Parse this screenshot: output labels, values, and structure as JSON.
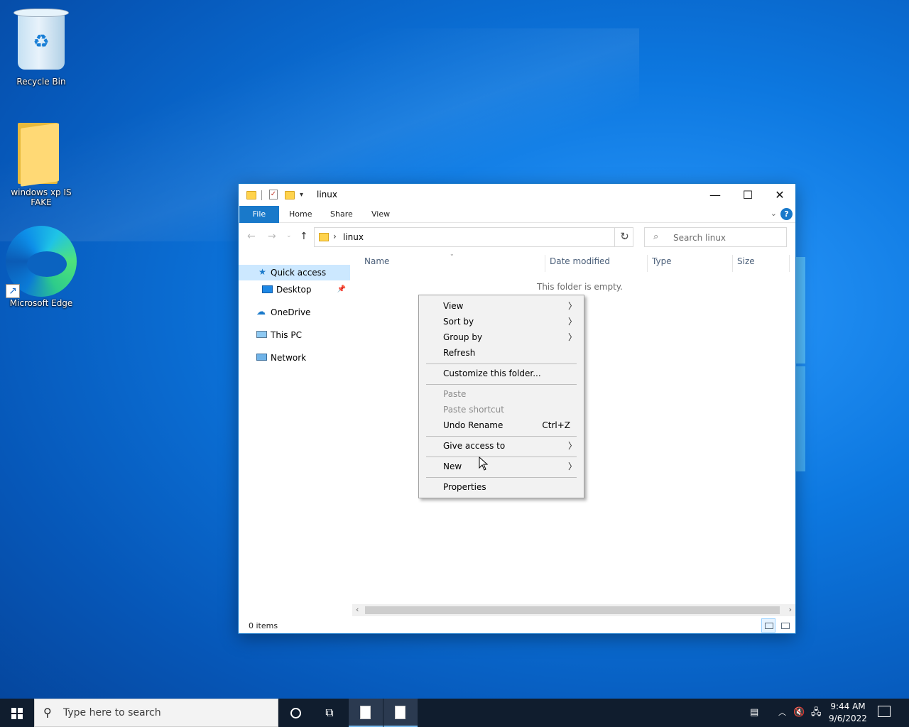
{
  "desktop": {
    "icons": [
      {
        "label": "Recycle Bin",
        "icon": "recycle-bin-icon"
      },
      {
        "label": "windows xp IS FAKE",
        "icon": "folder-icon"
      },
      {
        "label": "Microsoft Edge",
        "icon": "edge-icon"
      }
    ]
  },
  "explorer": {
    "title": "linux",
    "window_buttons": {
      "minimize": "—",
      "maximize": "☐",
      "close": "✕"
    },
    "ribbon_tabs": [
      "File",
      "Home",
      "Share",
      "View"
    ],
    "help": "?",
    "address": {
      "path": "linux",
      "separator": "›"
    },
    "search_placeholder": "Search linux",
    "nav_pane": [
      {
        "label": "Quick access",
        "icon": "star-icon",
        "selected": true
      },
      {
        "label": "Desktop",
        "icon": "desktop-icon",
        "pinned": true
      },
      {
        "label": "OneDrive",
        "icon": "cloud-icon"
      },
      {
        "label": "This PC",
        "icon": "computer-icon"
      },
      {
        "label": "Network",
        "icon": "network-icon"
      }
    ],
    "columns": [
      "Name",
      "Date modified",
      "Type",
      "Size"
    ],
    "empty_message": "This folder is empty.",
    "status": "0 items"
  },
  "context_menu": {
    "items": [
      {
        "label": "View",
        "submenu": true
      },
      {
        "label": "Sort by",
        "submenu": true
      },
      {
        "label": "Group by",
        "submenu": true
      },
      {
        "label": "Refresh"
      },
      {
        "label": "Customize this folder..."
      },
      {
        "label": "Paste",
        "disabled": true
      },
      {
        "label": "Paste shortcut",
        "disabled": true
      },
      {
        "label": "Undo Rename",
        "shortcut": "Ctrl+Z"
      },
      {
        "label": "Give access to",
        "submenu": true
      },
      {
        "label": "New",
        "submenu": true
      },
      {
        "label": "Properties"
      }
    ]
  },
  "taskbar": {
    "search_placeholder": "Type here to search",
    "time": "9:44 AM",
    "date": "9/6/2022"
  },
  "colors": {
    "accent": "#1979ca",
    "taskbar": "#101d2e",
    "selection": "#cce8ff"
  }
}
